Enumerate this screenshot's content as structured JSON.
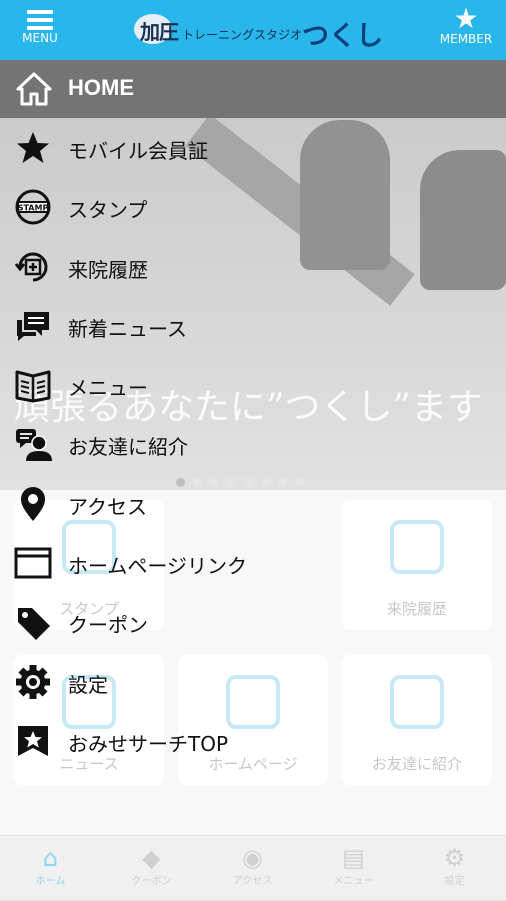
{
  "header": {
    "menu_label": "MENU",
    "member_label": "MEMBER",
    "logo_kanji": "加圧",
    "logo_small": "トレーニングスタジオ",
    "logo_big": "つくし",
    "color": "#29b6ea"
  },
  "background": {
    "tagline": "頑張るあなたに”つくし”ます",
    "tiles": [
      "スタンプ",
      "来院履歴",
      "ニュース",
      "ホームページ",
      "お友達に紹介"
    ],
    "tabs": [
      "ホーム",
      "クーポン",
      "アクセス",
      "メニュー",
      "設定"
    ]
  },
  "drawer": {
    "home": {
      "label": "HOME",
      "icon": "home-icon"
    },
    "items": [
      {
        "label": "モバイル会員証",
        "icon": "star-icon"
      },
      {
        "label": "スタンプ",
        "icon": "stamp-icon"
      },
      {
        "label": "来院履歴",
        "icon": "history-icon"
      },
      {
        "label": "新着ニュース",
        "icon": "chat-icon"
      },
      {
        "label": "メニュー",
        "icon": "book-icon"
      },
      {
        "label": "お友達に紹介",
        "icon": "friends-icon"
      },
      {
        "label": "アクセス",
        "icon": "map-pin-icon"
      },
      {
        "label": "ホームページリンク",
        "icon": "browser-icon"
      },
      {
        "label": "クーポン",
        "icon": "tag-icon"
      },
      {
        "label": "設定",
        "icon": "gear-icon"
      },
      {
        "label": "おみせサーチTOP",
        "icon": "bookmark-star-icon"
      }
    ]
  }
}
